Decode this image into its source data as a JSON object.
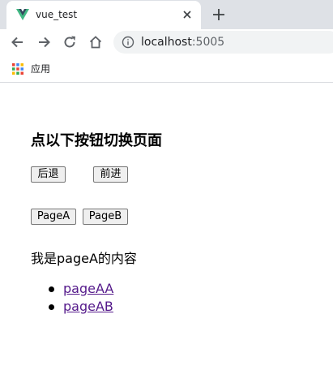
{
  "browser": {
    "tab": {
      "title": "vue_test",
      "favicon": "vue-logo-icon",
      "close_icon": "close-icon"
    },
    "new_tab_icon": "plus-icon",
    "toolbar": {
      "back_icon": "back-arrow-icon",
      "forward_icon": "forward-arrow-icon",
      "reload_icon": "reload-icon",
      "home_icon": "home-icon",
      "info_icon": "info-icon",
      "url_host": "localhost",
      "url_port": ":5005"
    },
    "bookmarks": {
      "apps_label": "应用",
      "apps_icon": "apps-grid-icon"
    }
  },
  "page": {
    "heading": "点以下按钮切换页面",
    "nav_buttons": {
      "back": "后退",
      "forward": "前进"
    },
    "page_buttons": {
      "a": "PageA",
      "b": "PageB"
    },
    "content": "我是pageA的内容",
    "links": [
      "pageAA",
      "pageAB"
    ]
  },
  "colors": {
    "tabstrip": "#dee1e6",
    "omnibox": "#f1f3f4",
    "vue_green": "#41b883",
    "vue_dark": "#35495e",
    "visited_link": "#551a8b"
  }
}
